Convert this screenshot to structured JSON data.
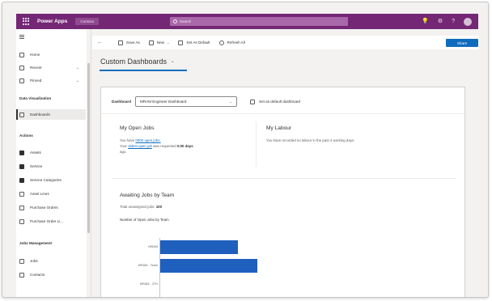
{
  "app": {
    "name": "Power Apps",
    "environment": "Contoso",
    "search_placeholder": "Search",
    "icons": [
      "lightbulb-icon",
      "settings-icon",
      "help-icon",
      "avatar"
    ]
  },
  "colors": {
    "topbar": "#742774",
    "accent": "#0f6cbd",
    "bar": "#1f5fbe"
  },
  "sidebar": {
    "top_items": [
      {
        "label": "Home",
        "icon": "home-icon"
      },
      {
        "label": "Recent",
        "icon": "clock-icon",
        "chevron": "⌄"
      },
      {
        "label": "Pinned",
        "icon": "pin-icon",
        "chevron": "⌄"
      }
    ],
    "section1": "Data Visualization",
    "section1_items": [
      {
        "label": "Dashboards",
        "icon": "dashboard-icon",
        "active": true
      }
    ],
    "section2": "Actions",
    "section2_items": [
      {
        "label": "Assets",
        "icon": "asset-icon"
      },
      {
        "label": "Service",
        "icon": "wrench-icon"
      },
      {
        "label": "Service Categories",
        "icon": "category-icon"
      },
      {
        "label": "Asset Lines",
        "icon": "list-icon"
      },
      {
        "label": "Purchase Orders",
        "icon": "document-icon"
      },
      {
        "label": "Purchase Order Li...",
        "icon": "document-icon"
      }
    ],
    "section3": "Jobs Management",
    "section3_items": [
      {
        "label": "Jobs",
        "icon": "job-icon"
      },
      {
        "label": "Contacts",
        "icon": "contact-icon"
      }
    ]
  },
  "command_bar": {
    "back": "←",
    "save_as": "Save As",
    "new": "New",
    "set_default": "Set As Default",
    "refresh_all": "Refresh All",
    "dropdown": "⌄",
    "share": "Share"
  },
  "title": {
    "text": "Custom Dashboards",
    "chevron": "⌄"
  },
  "dashboard": {
    "label": "Dashboard",
    "selected": "MRAM Engineer Dashboard",
    "select_chevron": "⌄",
    "default_button": "Set as default dashboard"
  },
  "cards": {
    "open_jobs": {
      "title": "My Open Jobs",
      "line1_prefix": "You have",
      "line1_link": "0000 open jobs.",
      "line2_link": "oldest open job",
      "line2_prefix": "Your",
      "line2_suffix": "was requested",
      "line2_bold": "0.00 days",
      "line2_end": "ago."
    },
    "labour": {
      "title": "My Labour",
      "text": "You have recorded no labour in the past 4 working days."
    },
    "awaiting": {
      "title": "Awaiting Jobs by Team",
      "subtitle_prefix": "Total unassigned jobs:",
      "subtitle_bold": "100",
      "chart_title": "Number of Open Jobs by Team"
    }
  },
  "chart_data": {
    "type": "bar",
    "orientation": "horizontal",
    "title": "Number of Open Jobs by Team",
    "categories": [
      "MRAM",
      "MRAM - Team",
      "MRAM - 2TH"
    ],
    "values": [
      48,
      60,
      0
    ],
    "xlim": [
      0,
      100
    ]
  }
}
